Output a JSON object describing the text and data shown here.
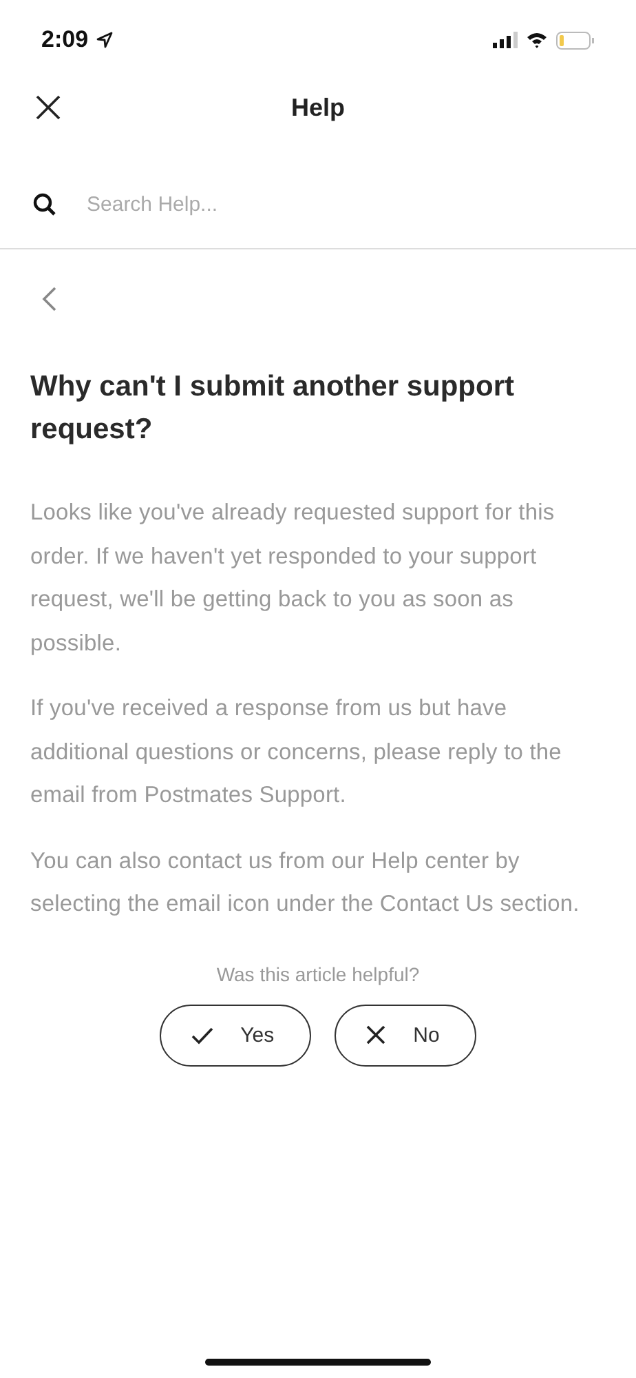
{
  "status_bar": {
    "time": "2:09"
  },
  "header": {
    "title": "Help"
  },
  "search": {
    "placeholder": "Search Help..."
  },
  "article": {
    "title": "Why can't I submit another support request?",
    "paragraphs": [
      "Looks like you've already requested support for this order. If we haven't yet responded to your support request, we'll be getting back to you as soon as possible.",
      "If you've received a response from us but have additional questions or concerns, please reply to the email from Postmates Support.",
      "You can also contact us from our Help center by selecting the email icon under the Contact Us section."
    ]
  },
  "feedback": {
    "question": "Was this article helpful?",
    "buttons": [
      {
        "kind": "yes",
        "label": "Yes"
      },
      {
        "kind": "no",
        "label": "No"
      }
    ]
  }
}
